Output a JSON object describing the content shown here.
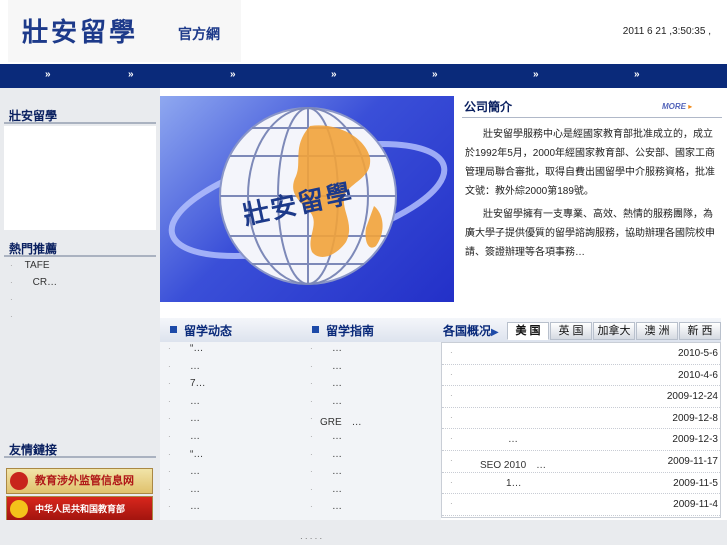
{
  "header": {
    "logo_main": "壯安留學",
    "logo_sub": "官方網",
    "datetime": "2011  6 21 ,3:50:35 ,"
  },
  "nav": {
    "items": [
      "»",
      "»",
      "»",
      "»",
      "»",
      "»",
      "»"
    ]
  },
  "left": {
    "box1_title": "壯安留學",
    "box2_title": "熱門推薦",
    "box2_items": [
      "TAFE",
      "CR…",
      "",
      ""
    ],
    "box3_title": "友情鏈接",
    "banner1": "教育涉外监管信息网",
    "banner2": "中华人民共和国教育部"
  },
  "hero": {
    "logo_text": "壯安留學"
  },
  "intro": {
    "title": "公司簡介",
    "more": "MORE",
    "paragraph1": "壯安留學服務中心是經國家教育部批准成立的，成立於1992年5月，2000年經國家教育部、公安部、國家工商管理局聯合審批，取得自費出國留學中介服務資格，批准文號：教外綜2000第189號。",
    "paragraph2": "壯安留學擁有一支專業、高效、熱情的服務團隊，為廣大學子提供優質的留學諮詢服務，協助辦理各國院校申請、簽證辦理等各項事務…"
  },
  "news": {
    "col1_title": "留学动态",
    "col1_items": [
      "“…",
      "…",
      "7…",
      "…",
      "…",
      "…",
      "“…",
      "…",
      "…",
      "…"
    ],
    "col2_title": "留学指南",
    "col2_items": [
      "…",
      "…",
      "…",
      "…",
      "GRE　…",
      "…",
      "…",
      "…",
      "…",
      "…"
    ]
  },
  "countries": {
    "title": "各国概况",
    "tabs": [
      "美 国",
      "英 国",
      "加拿大",
      "澳 洲",
      "新 西"
    ],
    "rows": [
      {
        "text": "",
        "date": "2010-5-6"
      },
      {
        "text": "",
        "date": "2010-4-6"
      },
      {
        "text": "",
        "date": "2009-12-24"
      },
      {
        "text": "",
        "date": "2009-12-8"
      },
      {
        "text": "…",
        "date": "2009-12-3"
      },
      {
        "text": "SEO 2010　…",
        "date": "2009-11-17"
      },
      {
        "text": "1…",
        "date": "2009-11-5"
      },
      {
        "text": "",
        "date": "2009-11-4"
      }
    ]
  },
  "footer": {
    "links": "· · · · ·"
  },
  "colors": {
    "nav": "#0a2a7a",
    "title": "#0a2060",
    "accent": "#1d4aa8"
  }
}
